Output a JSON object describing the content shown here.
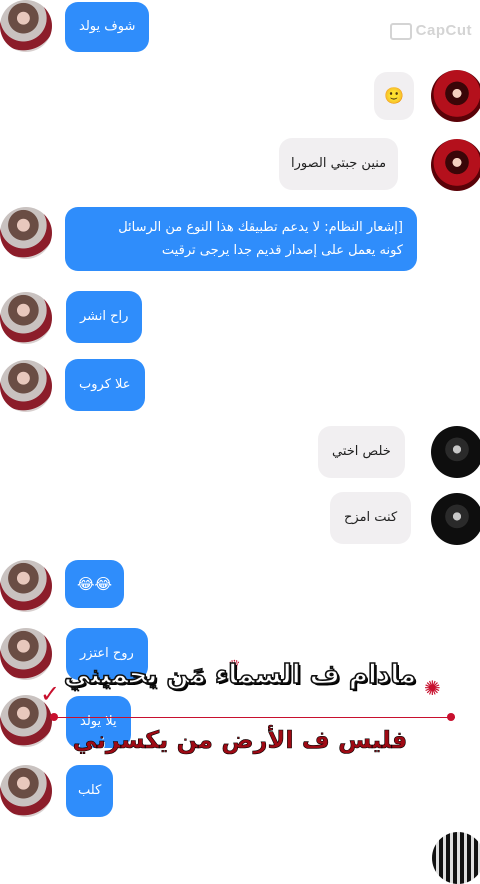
{
  "watermark": {
    "label": "CapCut"
  },
  "messages": [
    {
      "side": "in",
      "text": "شوف يولد"
    },
    {
      "side": "out",
      "text": "🙂"
    },
    {
      "side": "out",
      "text": "منين جبتي الصورا"
    },
    {
      "side": "in",
      "lines": [
        "[إشعار النظام: لا يدعم تطبيقك هذا النوع من الرسائل",
        "كونه يعمل على إصدار قديم جدا يرجى ترقيت"
      ]
    },
    {
      "side": "in",
      "text": "راح انشر"
    },
    {
      "side": "in",
      "text": "علا كروب"
    },
    {
      "side": "out",
      "text": "خلص اختي"
    },
    {
      "side": "out",
      "text": "كنت امزح"
    },
    {
      "side": "in",
      "text": "😂😂"
    },
    {
      "side": "in",
      "text": "روح اعتزر"
    },
    {
      "side": "in",
      "text": "يلا يولد"
    },
    {
      "side": "in",
      "text": "كلب"
    }
  ],
  "overlay": {
    "line1": "مادام ف السماء مَن يحميني",
    "line2": "فليس ف الأرض من يكسرني",
    "colors": {
      "line1": "#ffffff",
      "line2": "#9e0a14",
      "accent": "#c8102e"
    }
  },
  "colors": {
    "incoming": "#2f8dfb",
    "outgoing": "#f1eff1",
    "background": "#ffffff"
  }
}
